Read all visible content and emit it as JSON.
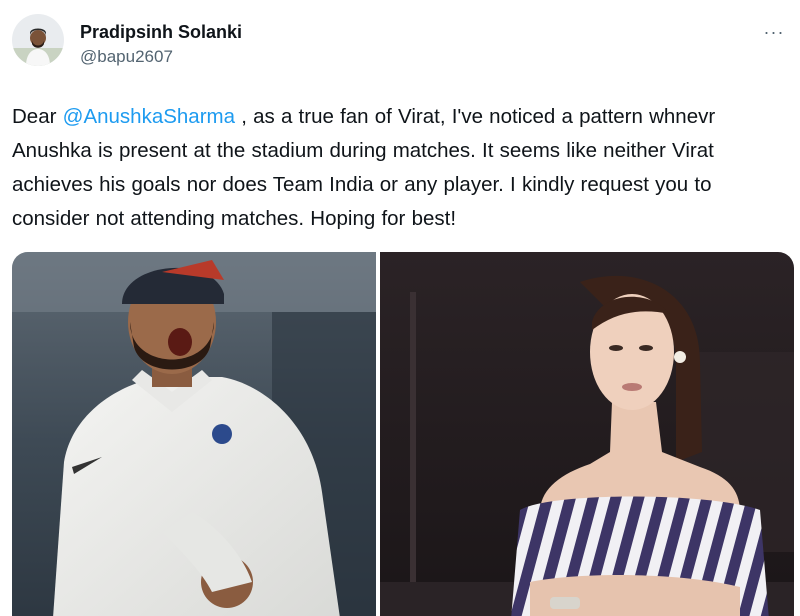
{
  "author": {
    "display_name": "Pradipsinh Solanki",
    "handle": "@bapu2607",
    "avatar_icon": "avatar-photo"
  },
  "more_icon": "more-horizontal-icon",
  "more_glyph": "···",
  "tweet": {
    "text_before": "Dear ",
    "mention": "@AnushkaSharma",
    "text_after": " , as a true fan of Virat, I've noticed a pattern whnevr Anushka is present at the stadium during matches. It seems like neither Virat achieves his goals nor does Team India or any player. I kindly request you to consider not attending matches. Hoping for best!"
  },
  "colors": {
    "text": "#0f1419",
    "secondary": "#536471",
    "link": "#1d9bf0"
  },
  "media": {
    "photo_count": 2
  }
}
